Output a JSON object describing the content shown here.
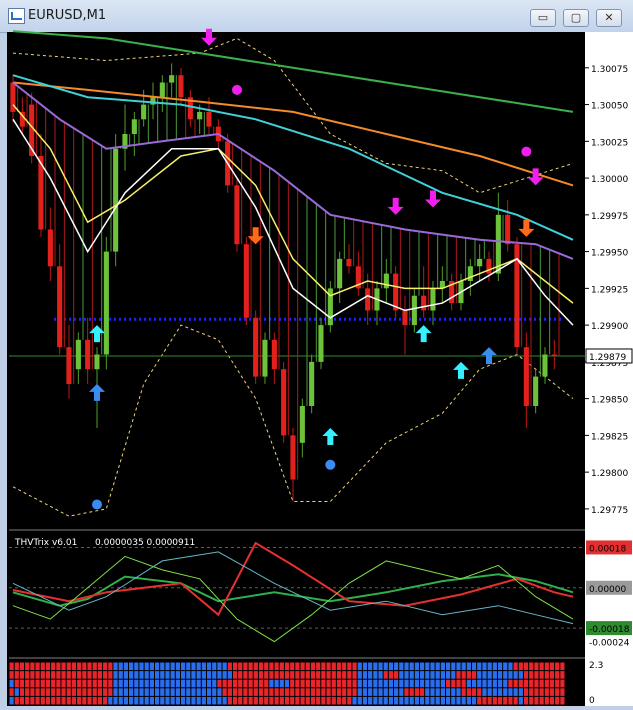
{
  "window": {
    "title": "EURUSD,M1",
    "min_label": "▭",
    "max_label": "▢",
    "close_label": "✕"
  },
  "icons": [
    "chart-app-icon",
    "minimize-icon",
    "maximize-icon",
    "close-icon",
    "arrow-up-icon",
    "arrow-down-icon"
  ],
  "chart_data": [
    {
      "type": "candlestick",
      "symbol": "EURUSD",
      "timeframe": "M1",
      "y_axis": {
        "min": 1.29762,
        "max": 1.30098
      },
      "y_ticks": [
        "1.30075",
        "1.30050",
        "1.30025",
        "1.30000",
        "1.29975",
        "1.29950",
        "1.29925",
        "1.29900",
        "1.29875",
        "1.29850",
        "1.29825",
        "1.29800",
        "1.29775"
      ],
      "current_price": "1.29879",
      "x_range": [
        0,
        60
      ],
      "candles": [
        [
          1.30065,
          1.3007,
          1.30038,
          1.30045
        ],
        [
          1.30045,
          1.30055,
          1.3003,
          1.30035
        ],
        [
          1.3005,
          1.30058,
          1.3001,
          1.30015
        ],
        [
          1.30015,
          1.3003,
          1.2996,
          1.29965
        ],
        [
          1.29965,
          1.2998,
          1.2993,
          1.2994
        ],
        [
          1.2994,
          1.29955,
          1.2988,
          1.29885
        ],
        [
          1.29885,
          1.299,
          1.2985,
          1.2986
        ],
        [
          1.2987,
          1.29895,
          1.2986,
          1.2989
        ],
        [
          1.2989,
          1.29905,
          1.2986,
          1.2987
        ],
        [
          1.2987,
          1.29885,
          1.2983,
          1.2988
        ],
        [
          1.2988,
          1.2996,
          1.2987,
          1.2995
        ],
        [
          1.2995,
          1.3003,
          1.2994,
          1.3002
        ],
        [
          1.3002,
          1.3005,
          1.30005,
          1.3003
        ],
        [
          1.3003,
          1.30045,
          1.30015,
          1.3004
        ],
        [
          1.3004,
          1.3006,
          1.30035,
          1.3005
        ],
        [
          1.3005,
          1.30065,
          1.3004,
          1.30055
        ],
        [
          1.30055,
          1.3007,
          1.30045,
          1.30065
        ],
        [
          1.30065,
          1.30078,
          1.30055,
          1.3007
        ],
        [
          1.3007,
          1.30075,
          1.3005,
          1.30055
        ],
        [
          1.30055,
          1.3006,
          1.30035,
          1.3004
        ],
        [
          1.3004,
          1.3005,
          1.3003,
          1.30045
        ],
        [
          1.30045,
          1.30055,
          1.3003,
          1.30035
        ],
        [
          1.30035,
          1.3004,
          1.3002,
          1.30025
        ],
        [
          1.30025,
          1.3003,
          1.2999,
          1.29995
        ],
        [
          1.29995,
          1.3,
          1.2995,
          1.29955
        ],
        [
          1.29955,
          1.2996,
          1.299,
          1.29905
        ],
        [
          1.29905,
          1.2991,
          1.2986,
          1.29865
        ],
        [
          1.29865,
          1.29895,
          1.2986,
          1.2989
        ],
        [
          1.2989,
          1.29895,
          1.2986,
          1.2987
        ],
        [
          1.2987,
          1.29875,
          1.2982,
          1.29825
        ],
        [
          1.29825,
          1.2983,
          1.2978,
          1.29795
        ],
        [
          1.2982,
          1.2985,
          1.2981,
          1.29845
        ],
        [
          1.29845,
          1.2988,
          1.2984,
          1.29875
        ],
        [
          1.29875,
          1.29905,
          1.2987,
          1.299
        ],
        [
          1.299,
          1.2993,
          1.29895,
          1.29925
        ],
        [
          1.29925,
          1.2995,
          1.29915,
          1.29945
        ],
        [
          1.29945,
          1.29955,
          1.29935,
          1.2994
        ],
        [
          1.2994,
          1.2995,
          1.2992,
          1.29925
        ],
        [
          1.29925,
          1.29935,
          1.299,
          1.2991
        ],
        [
          1.2991,
          1.2993,
          1.299,
          1.29925
        ],
        [
          1.29925,
          1.29945,
          1.29915,
          1.29935
        ],
        [
          1.29935,
          1.2994,
          1.29905,
          1.2991
        ],
        [
          1.2991,
          1.2992,
          1.2988,
          1.299
        ],
        [
          1.299,
          1.29925,
          1.29895,
          1.2992
        ],
        [
          1.2992,
          1.2994,
          1.29905,
          1.2991
        ],
        [
          1.2991,
          1.2993,
          1.299,
          1.29925
        ],
        [
          1.29925,
          1.2994,
          1.29915,
          1.2993
        ],
        [
          1.2993,
          1.29935,
          1.2991,
          1.29915
        ],
        [
          1.29915,
          1.29935,
          1.2991,
          1.2993
        ],
        [
          1.2993,
          1.29945,
          1.2992,
          1.2994
        ],
        [
          1.2994,
          1.29955,
          1.2993,
          1.29945
        ],
        [
          1.29945,
          1.2995,
          1.2993,
          1.29935
        ],
        [
          1.29935,
          1.2999,
          1.2993,
          1.29975
        ],
        [
          1.29975,
          1.29985,
          1.2995,
          1.29955
        ],
        [
          1.29955,
          1.2996,
          1.2988,
          1.29885
        ],
        [
          1.29885,
          1.29895,
          1.2983,
          1.29845
        ],
        [
          1.29845,
          1.2987,
          1.2984,
          1.29865
        ],
        [
          1.29865,
          1.29885,
          1.2986,
          1.2988
        ],
        [
          1.2988,
          1.2989,
          1.2987,
          1.29879
        ]
      ],
      "indicators": {
        "support_level": 1.29904,
        "ma_orange": [
          [
            0,
            1.30065
          ],
          [
            8,
            1.3006
          ],
          [
            20,
            1.30052
          ],
          [
            30,
            1.30045
          ],
          [
            40,
            1.3003
          ],
          [
            50,
            1.30015
          ],
          [
            60,
            1.29995
          ]
        ],
        "ma_green": [
          [
            0,
            1.301
          ],
          [
            10,
            1.30095
          ],
          [
            20,
            1.30085
          ],
          [
            30,
            1.30075
          ],
          [
            40,
            1.30065
          ],
          [
            50,
            1.30055
          ],
          [
            60,
            1.30045
          ]
        ],
        "ma_cyan": [
          [
            0,
            1.3007
          ],
          [
            8,
            1.30055
          ],
          [
            18,
            1.3005
          ],
          [
            26,
            1.3004
          ],
          [
            36,
            1.3002
          ],
          [
            46,
            1.2999
          ],
          [
            54,
            1.29975
          ],
          [
            60,
            1.29958
          ]
        ],
        "ma_violet": [
          [
            0,
            1.30065
          ],
          [
            5,
            1.3004
          ],
          [
            10,
            1.3002
          ],
          [
            16,
            1.30025
          ],
          [
            22,
            1.3003
          ],
          [
            28,
            1.30005
          ],
          [
            34,
            1.29975
          ],
          [
            42,
            1.29965
          ],
          [
            50,
            1.29958
          ],
          [
            56,
            1.29955
          ],
          [
            60,
            1.29945
          ]
        ],
        "ma_yellow": [
          [
            0,
            1.3005
          ],
          [
            4,
            1.3002
          ],
          [
            8,
            1.2997
          ],
          [
            12,
            1.29985
          ],
          [
            18,
            1.30015
          ],
          [
            22,
            1.3002
          ],
          [
            26,
            1.29995
          ],
          [
            30,
            1.29945
          ],
          [
            34,
            1.2992
          ],
          [
            38,
            1.2993
          ],
          [
            42,
            1.29925
          ],
          [
            46,
            1.29925
          ],
          [
            50,
            1.29935
          ],
          [
            54,
            1.29945
          ],
          [
            57,
            1.2993
          ],
          [
            60,
            1.29915
          ]
        ],
        "ma_white": [
          [
            0,
            1.3004
          ],
          [
            4,
            1.3
          ],
          [
            8,
            1.2995
          ],
          [
            12,
            1.2999
          ],
          [
            17,
            1.3002
          ],
          [
            22,
            1.3002
          ],
          [
            26,
            1.2998
          ],
          [
            30,
            1.29925
          ],
          [
            34,
            1.29905
          ],
          [
            38,
            1.2992
          ],
          [
            42,
            1.2991
          ],
          [
            46,
            1.29915
          ],
          [
            50,
            1.2993
          ],
          [
            54,
            1.29945
          ],
          [
            57,
            1.2992
          ],
          [
            60,
            1.299
          ]
        ],
        "band_upper": [
          [
            0,
            1.30085
          ],
          [
            10,
            1.3008
          ],
          [
            20,
            1.30085
          ],
          [
            24,
            1.30095
          ],
          [
            28,
            1.3008
          ],
          [
            34,
            1.3003
          ],
          [
            40,
            1.3001
          ],
          [
            46,
            1.30005
          ],
          [
            50,
            1.2999
          ],
          [
            55,
            1.3
          ],
          [
            60,
            1.3001
          ]
        ],
        "band_lower": [
          [
            0,
            1.2979
          ],
          [
            6,
            1.2977
          ],
          [
            10,
            1.29775
          ],
          [
            14,
            1.2986
          ],
          [
            18,
            1.299
          ],
          [
            22,
            1.2989
          ],
          [
            26,
            1.2985
          ],
          [
            30,
            1.2978
          ],
          [
            34,
            1.2978
          ],
          [
            40,
            1.2982
          ],
          [
            46,
            1.2984
          ],
          [
            50,
            1.2987
          ],
          [
            54,
            1.2988
          ],
          [
            60,
            1.2985
          ]
        ],
        "arrows_up": [
          [
            9,
            1.299,
            "cyan"
          ],
          [
            9,
            1.2986,
            "blue"
          ],
          [
            34,
            1.2983,
            "cyan"
          ],
          [
            44,
            1.299,
            "cyan"
          ],
          [
            48,
            1.29875,
            "cyan"
          ],
          [
            51,
            1.29885,
            "blue"
          ]
        ],
        "arrows_down": [
          [
            21,
            1.3009,
            "magenta"
          ],
          [
            41,
            1.29975,
            "magenta"
          ],
          [
            45,
            1.2998,
            "magenta"
          ],
          [
            56,
            1.29995,
            "magenta"
          ],
          [
            26,
            1.29955,
            "orange"
          ],
          [
            55,
            1.2996,
            "orange"
          ]
        ],
        "dots": [
          [
            24,
            1.3006,
            "magenta"
          ],
          [
            55,
            1.30018,
            "magenta"
          ],
          [
            34,
            1.29805,
            "blue"
          ],
          [
            9,
            1.29778,
            "blue"
          ]
        ]
      }
    },
    {
      "type": "line",
      "title": "THVTrix v6.01",
      "values_label": "0.0000035  0.0000911",
      "y_ticks": [
        "0.00018",
        "0.00000",
        "-0.00018",
        "-0.00024"
      ],
      "y_range": [
        -0.0003,
        0.00024
      ],
      "levels": [
        0.00018,
        0.0,
        -0.00018
      ],
      "series": [
        {
          "color": "#2fb04a",
          "points": [
            [
              0,
              -2e-05
            ],
            [
              5,
              -8e-05
            ],
            [
              8,
              -5e-05
            ],
            [
              12,
              5e-05
            ],
            [
              18,
              2e-05
            ],
            [
              22,
              -6e-05
            ],
            [
              28,
              -2e-05
            ],
            [
              34,
              -6e-05
            ],
            [
              40,
              -2e-05
            ],
            [
              46,
              3e-05
            ],
            [
              52,
              6e-05
            ],
            [
              56,
              3e-05
            ],
            [
              60,
              -2e-05
            ]
          ]
        },
        {
          "color": "#e63030",
          "points": [
            [
              0,
              -1e-05
            ],
            [
              6,
              -6e-05
            ],
            [
              10,
              -2e-05
            ],
            [
              18,
              2e-05
            ],
            [
              22,
              -0.00012
            ],
            [
              26,
              0.0002
            ],
            [
              30,
              0.0001
            ],
            [
              36,
              -6e-05
            ],
            [
              42,
              -8e-05
            ],
            [
              48,
              -3e-05
            ],
            [
              54,
              4e-05
            ],
            [
              58,
              -2e-05
            ],
            [
              60,
              -4e-05
            ]
          ]
        },
        {
          "color": "#7fe04a",
          "points": [
            [
              0,
              -8e-05
            ],
            [
              4,
              -0.00014
            ],
            [
              8,
              0.0
            ],
            [
              12,
              0.00014
            ],
            [
              16,
              8e-05
            ],
            [
              20,
              4e-05
            ],
            [
              24,
              -0.00014
            ],
            [
              28,
              -0.00024
            ],
            [
              32,
              -0.00012
            ],
            [
              36,
              2e-05
            ],
            [
              40,
              0.00012
            ],
            [
              44,
              8e-05
            ],
            [
              48,
              4e-05
            ],
            [
              52,
              0.0001
            ],
            [
              56,
              -4e-05
            ],
            [
              60,
              -0.00014
            ]
          ]
        },
        {
          "color": "#67b7c8",
          "points": [
            [
              0,
              2e-05
            ],
            [
              6,
              -0.0001
            ],
            [
              10,
              -4e-05
            ],
            [
              16,
              0.00012
            ],
            [
              22,
              0.00016
            ],
            [
              28,
              2e-05
            ],
            [
              34,
              -0.0001
            ],
            [
              40,
              -6e-05
            ],
            [
              46,
              -0.00012
            ],
            [
              52,
              -8e-05
            ],
            [
              56,
              -0.00012
            ],
            [
              60,
              -0.00016
            ]
          ]
        }
      ]
    },
    {
      "type": "heatmap",
      "y_ticks": [
        "2.3",
        "0"
      ],
      "rows": [
        "RRRRRRRRRRRRRRRRRRRRBBBBBBBBBBBBBBBBBBBBBBRRRRRRRRRRRRRRRRRRRRRRRRRBBBBBBBBBBBBBBBBBBBBBBBBBBBBBBRRRRRRRRRR",
        "RRRRRRRRRRRRRRRRRRRRBBBBBBBBBBBBBBBBBBBBBBBRRRRRRRRRRRRRRRRRRRRRRRRBBBBBRRRBBBBBBBBBBBRRRRBBBBBBBBBRRRRRRRRR",
        "BRRRRRRRRRRRRRRRRRRRBBBBBBBBBBBBBBBBBBBBRRRRRRRRRRBBBBRRRRRRRRRRRRRBBBBBBBBBBBBBBBBBRRRRBBBBBBBBRRRRRRRRRRRR",
        "RBRRRRRRRRRRRRRRRRRRBBBBBBBBBBBBBBBBBBBBBRRRRRRRRRRRRRRRRRRRRRRRRRRBBBBBBBBBRRRRBBBBBBBRRRRBBBBBBBBRRRRRRRRR",
        "BRRRRRRRRRRRRRRRRRRBBBBBBBBBBBBBBBBBBBBBBBRRRRRRRRRRRRRRRRRRRRRRRRBBBBBBBBBBBBBBBBBBBBBBBBRRRRRRRRBRRRRRRRRR"
      ],
      "colors": {
        "R": "#e8252a",
        "B": "#2a6ef0"
      }
    }
  ],
  "colors": {
    "up_candle": "#6cc23a",
    "down_candle": "#e3211c",
    "wick_red": "#c0181a",
    "ma_orange": "#f58a2a",
    "ma_green": "#3cb04a",
    "ma_cyan": "#3fd0d8",
    "ma_violet": "#9a6ad8",
    "ma_yellow": "#f7ef6a",
    "ma_white": "#ffffff",
    "support": "#1f22ff",
    "grid": "#5e5e5e",
    "price_tag_bg": "#ffffff"
  }
}
